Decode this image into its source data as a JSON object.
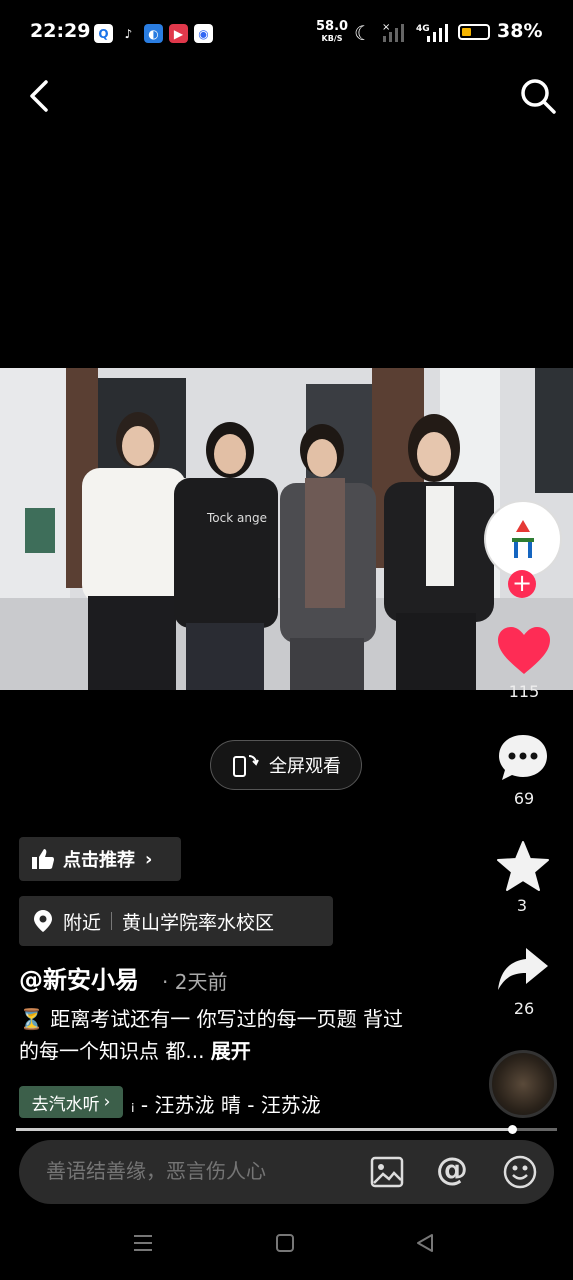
{
  "status_bar": {
    "time": "22:29",
    "net_speed": "58.0",
    "net_unit": "KB/S",
    "network": "4G",
    "battery": "38%",
    "battery_color": "#f5b400"
  },
  "nav": {
    "back_icon": "chevron-left-icon",
    "search_icon": "search-icon"
  },
  "rail": {
    "likes": "115",
    "comments": "69",
    "favorites": "3",
    "shares": "26",
    "like_color": "#fe2c55"
  },
  "fullscreen_label": "全屏观看",
  "recommend_label": "点击推荐",
  "location": {
    "prefix": "附近",
    "place": "黄山学院率水校区"
  },
  "author": "@新安小易",
  "time_ago": "· 2天前",
  "description": {
    "text": "⏳ 距离考试还有一 你写过的每一页题 背过的每一个知识点 都...",
    "expand": "展开"
  },
  "music": {
    "button": "去汽水听",
    "title": "ᵢ - 汪苏泷    晴 - 汪苏泷"
  },
  "comment": {
    "placeholder": "善语结善缘，恶言伤人心"
  }
}
